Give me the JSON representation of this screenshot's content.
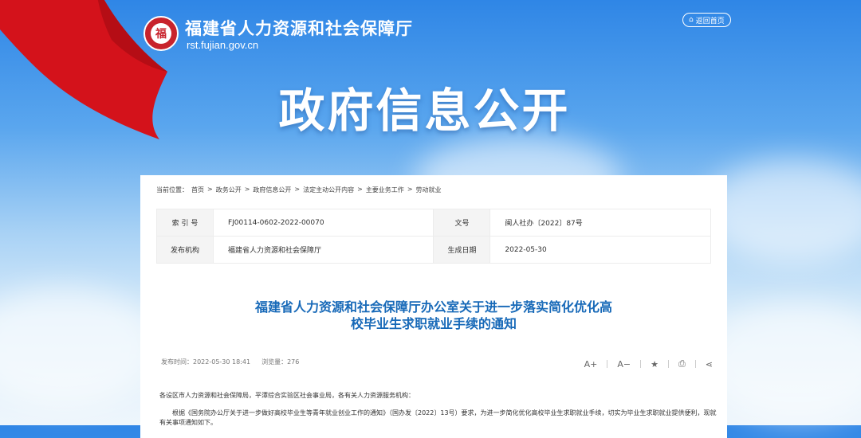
{
  "header": {
    "site_title": "福建省人力资源和社会保障厅",
    "site_url": "rst.fujian.gov.cn",
    "logo_char": "福",
    "back_home": "返回首页"
  },
  "hero": {
    "title": "政府信息公开"
  },
  "breadcrumb": {
    "prefix": "当前位置：",
    "items": [
      "首页",
      "政务公开",
      "政府信息公开",
      "法定主动公开内容",
      "主要业务工作",
      "劳动就业"
    ]
  },
  "meta": {
    "index_label": "索 引 号",
    "index_value": "FJ00114-0602-2022-00070",
    "docno_label": "文号",
    "docno_value": "闽人社办〔2022〕87号",
    "issuer_label": "发布机构",
    "issuer_value": "福建省人力资源和社会保障厅",
    "date_label": "生成日期",
    "date_value": "2022-05-30"
  },
  "document": {
    "title_line1": "福建省人力资源和社会保障厅办公室关于进一步落实简化优化高",
    "title_line2": "校毕业生求职就业手续的通知",
    "publish_time": "发布时间：2022-05-30 18:41",
    "views": "浏览量：276",
    "para1": "各设区市人力资源和社会保障局，平潭综合实验区社会事业局，各有关人力资源服务机构：",
    "para2": "根据《国务院办公厅关于进一步做好高校毕业生等青年就业创业工作的通知》（国办发〔2022〕13号）要求，为进一步简化优化高校毕业生求职就业手续，切实为毕业生求职就业提供便利，现就有关事项通知如下。"
  },
  "tools": {
    "font_up": "A+",
    "font_down": "A−",
    "favorite": "★",
    "print": "⎙",
    "share": "⋖"
  },
  "colors": {
    "title_blue": "#1769b8",
    "flag_red": "#d4121b"
  }
}
